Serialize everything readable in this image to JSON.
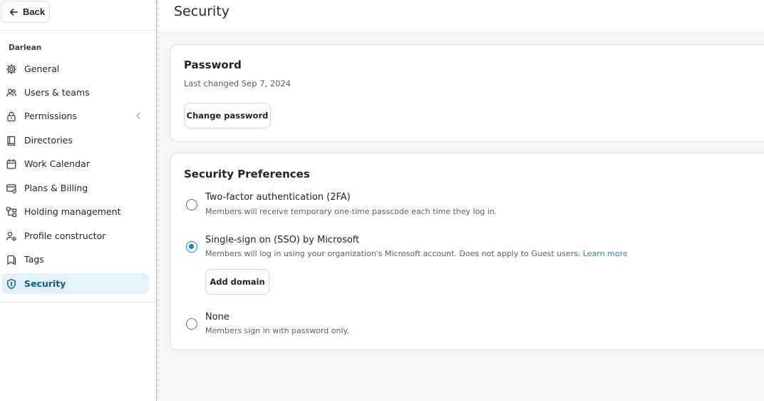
{
  "sidebar": {
    "back_label": "Back",
    "org_name": "Darlean",
    "items": [
      {
        "label": "General",
        "icon": "gear-icon"
      },
      {
        "label": "Users & teams",
        "icon": "users-icon"
      },
      {
        "label": "Permissions",
        "icon": "lock-icon"
      },
      {
        "label": "Directories",
        "icon": "book-icon"
      },
      {
        "label": "Work Calendar",
        "icon": "calendar-icon"
      },
      {
        "label": "Plans & Billing",
        "icon": "billing-icon"
      },
      {
        "label": "Holding management",
        "icon": "hierarchy-icon"
      },
      {
        "label": "Profile constructor",
        "icon": "profile-gear-icon"
      },
      {
        "label": "Tags",
        "icon": "tag-icon"
      },
      {
        "label": "Security",
        "icon": "shield-icon",
        "active": true
      }
    ]
  },
  "header": {
    "title": "Security"
  },
  "password": {
    "title": "Password",
    "last_changed": "Last changed Sep 7, 2024",
    "change_button": "Change password"
  },
  "preferences": {
    "title": "Security Preferences",
    "options": [
      {
        "label": "Two-factor authentication (2FA)",
        "description": "Members will receive temporary one-time passcode each time they log in.",
        "selected": false
      },
      {
        "label": "Single-sign on (SSO) by Microsoft",
        "description": "Members will log in using your organization's Microsoft account. Does not apply to Guest users.",
        "link": "Learn more",
        "selected": true,
        "button": "Add domain"
      },
      {
        "label": "None",
        "description": "Members sign in with password only.",
        "selected": false
      }
    ]
  },
  "colors": {
    "accent": "#1a7fc6",
    "active_bg": "#e3f1fb",
    "active_text": "#0c5b8c",
    "link": "#1a8fc6"
  }
}
